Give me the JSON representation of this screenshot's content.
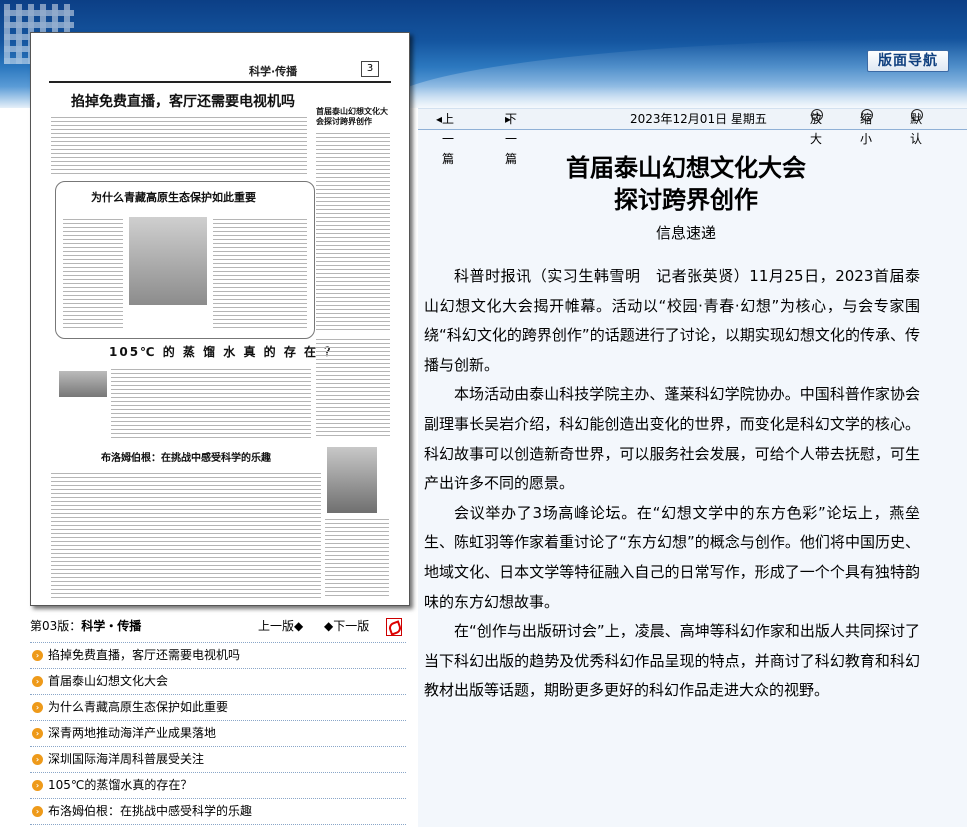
{
  "header": {
    "nav_button": "版面导航"
  },
  "newspaper": {
    "section_header": "科学·传播",
    "page_number": "3",
    "headlines": {
      "main": "掐掉免费直播，客厅还需要电视机吗",
      "box": "为什么青藏高原生态保护如此重要",
      "middle": "105℃ 的 蒸 馏 水 真 的 存 在 ？",
      "lower": "布洛姆伯根：在挑战中感受科学的乐趣",
      "side_top": "首届泰山幻想文化大会探讨跨界创作"
    }
  },
  "page_nav": {
    "page_label": "第03版：",
    "page_name": "科学・传播",
    "prev_page": "上一版",
    "next_page": "下一版",
    "pdf_icon": "pdf-icon"
  },
  "article_list": [
    "掐掉免费直播，客厅还需要电视机吗",
    "首届泰山幻想文化大会",
    "为什么青藏高原生态保护如此重要",
    "深青两地推动海洋产业成果落地",
    "深圳国际海洋周科普展受关注",
    "105℃的蒸馏水真的存在？",
    "布洛姆伯根：在挑战中感受科学的乐趣"
  ],
  "toolbar": {
    "prev_article": "上一篇",
    "next_article": "下一篇",
    "date": "2023年12月01日 星期五",
    "zoom_in": "放大",
    "zoom_out": "缩小",
    "default": "默认"
  },
  "article": {
    "title_line1": "首届泰山幻想文化大会",
    "title_line2": "探讨跨界创作",
    "column": "信息速递",
    "paragraphs": [
      "科普时报讯（实习生韩雪明　记者张英贤）11月25日，2023首届泰山幻想文化大会揭开帷幕。活动以“校园·青春·幻想”为核心，与会专家围绕“科幻文化的跨界创作”的话题进行了讨论，以期实现幻想文化的传承、传播与创新。",
      "本场活动由泰山科技学院主办、蓬莱科幻学院协办。中国科普作家协会副理事长吴岩介绍，科幻能创造出变化的世界，而变化是科幻文学的核心。科幻故事可以创造新奇世界，可以服务社会发展，可给个人带去抚慰，可生产出许多不同的愿景。",
      "会议举办了3场高峰论坛。在“幻想文学中的东方色彩”论坛上，燕垒生、陈虹羽等作家着重讨论了“东方幻想”的概念与创作。他们将中国历史、地域文化、日本文学等特征融入自己的日常写作，形成了一个个具有独特韵味的东方幻想故事。",
      "在“创作与出版研讨会”上，凌晨、高坤等科幻作家和出版人共同探讨了当下科幻出版的趋势及优秀科幻作品呈现的特点，并商讨了科幻教育和科幻教材出版等话题，期盼更多更好的科幻作品走进大众的视野。"
    ]
  }
}
